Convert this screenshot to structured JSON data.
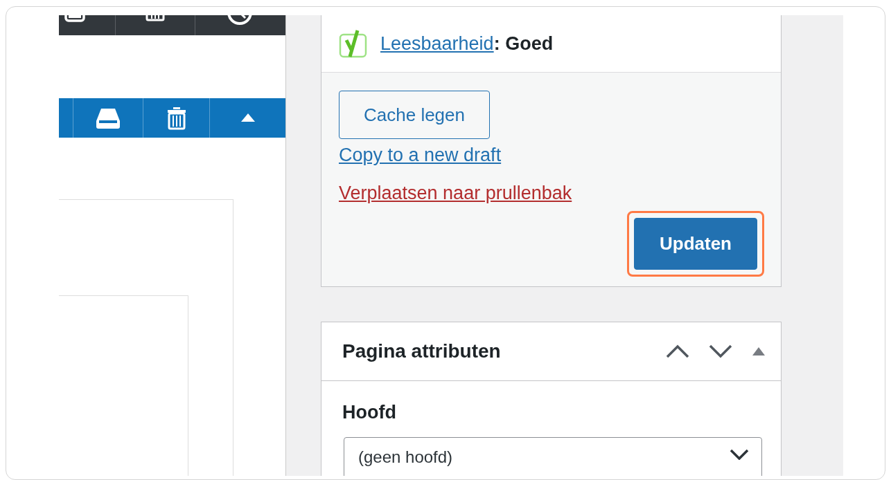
{
  "readability": {
    "link": "Leesbaarheid",
    "status": ": Goed"
  },
  "actions": {
    "cache_button": "Cache legen",
    "copy_link": "Copy to a new draft",
    "trash_link": "Verplaatsen naar prullenbak",
    "update_button": {
      "label": "Updaten",
      "highlighted": true
    }
  },
  "page_attributes": {
    "title": "Pagina attributen",
    "parent_label": "Hoofd",
    "parent_select": {
      "value": "(geen hoofd)"
    }
  }
}
